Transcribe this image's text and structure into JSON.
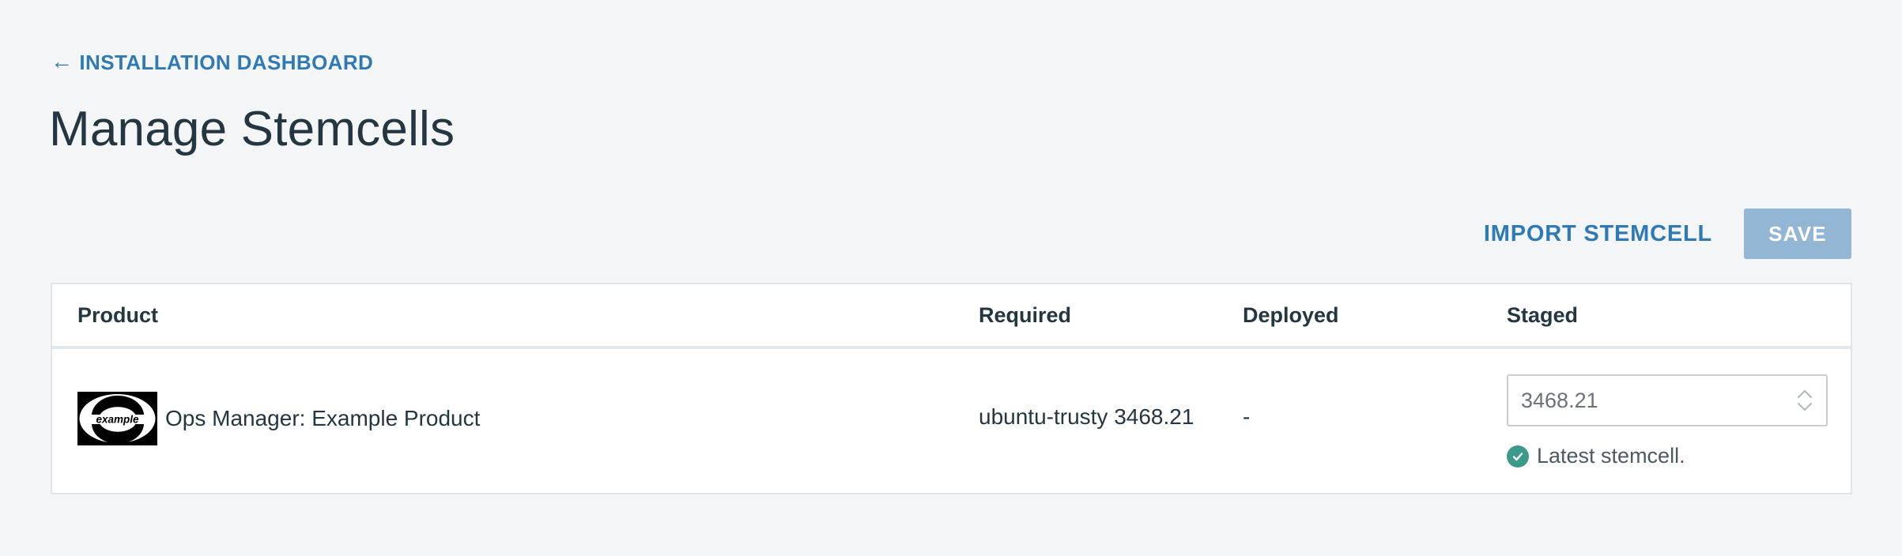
{
  "nav": {
    "back_arrow": "←",
    "back_label": "INSTALLATION DASHBOARD"
  },
  "page": {
    "title": "Manage Stemcells"
  },
  "actions": {
    "import_label": "IMPORT STEMCELL",
    "save_label": "SAVE"
  },
  "table": {
    "headers": {
      "product": "Product",
      "required": "Required",
      "deployed": "Deployed",
      "staged": "Staged"
    },
    "rows": [
      {
        "logo_text": "example",
        "product": "Ops Manager: Example Product",
        "required": "ubuntu-trusty 3468.21",
        "deployed": "-",
        "staged_value": "3468.21",
        "status": "Latest stemcell."
      }
    ]
  },
  "colors": {
    "accent": "#2f7ab5",
    "save_disabled": "#93b6d4",
    "success": "#3d9a8b",
    "background": "#f4f5f7"
  },
  "icons": {
    "back": "arrow-left-icon",
    "select": "chevron-up-down-icon",
    "status": "check-circle-icon"
  }
}
